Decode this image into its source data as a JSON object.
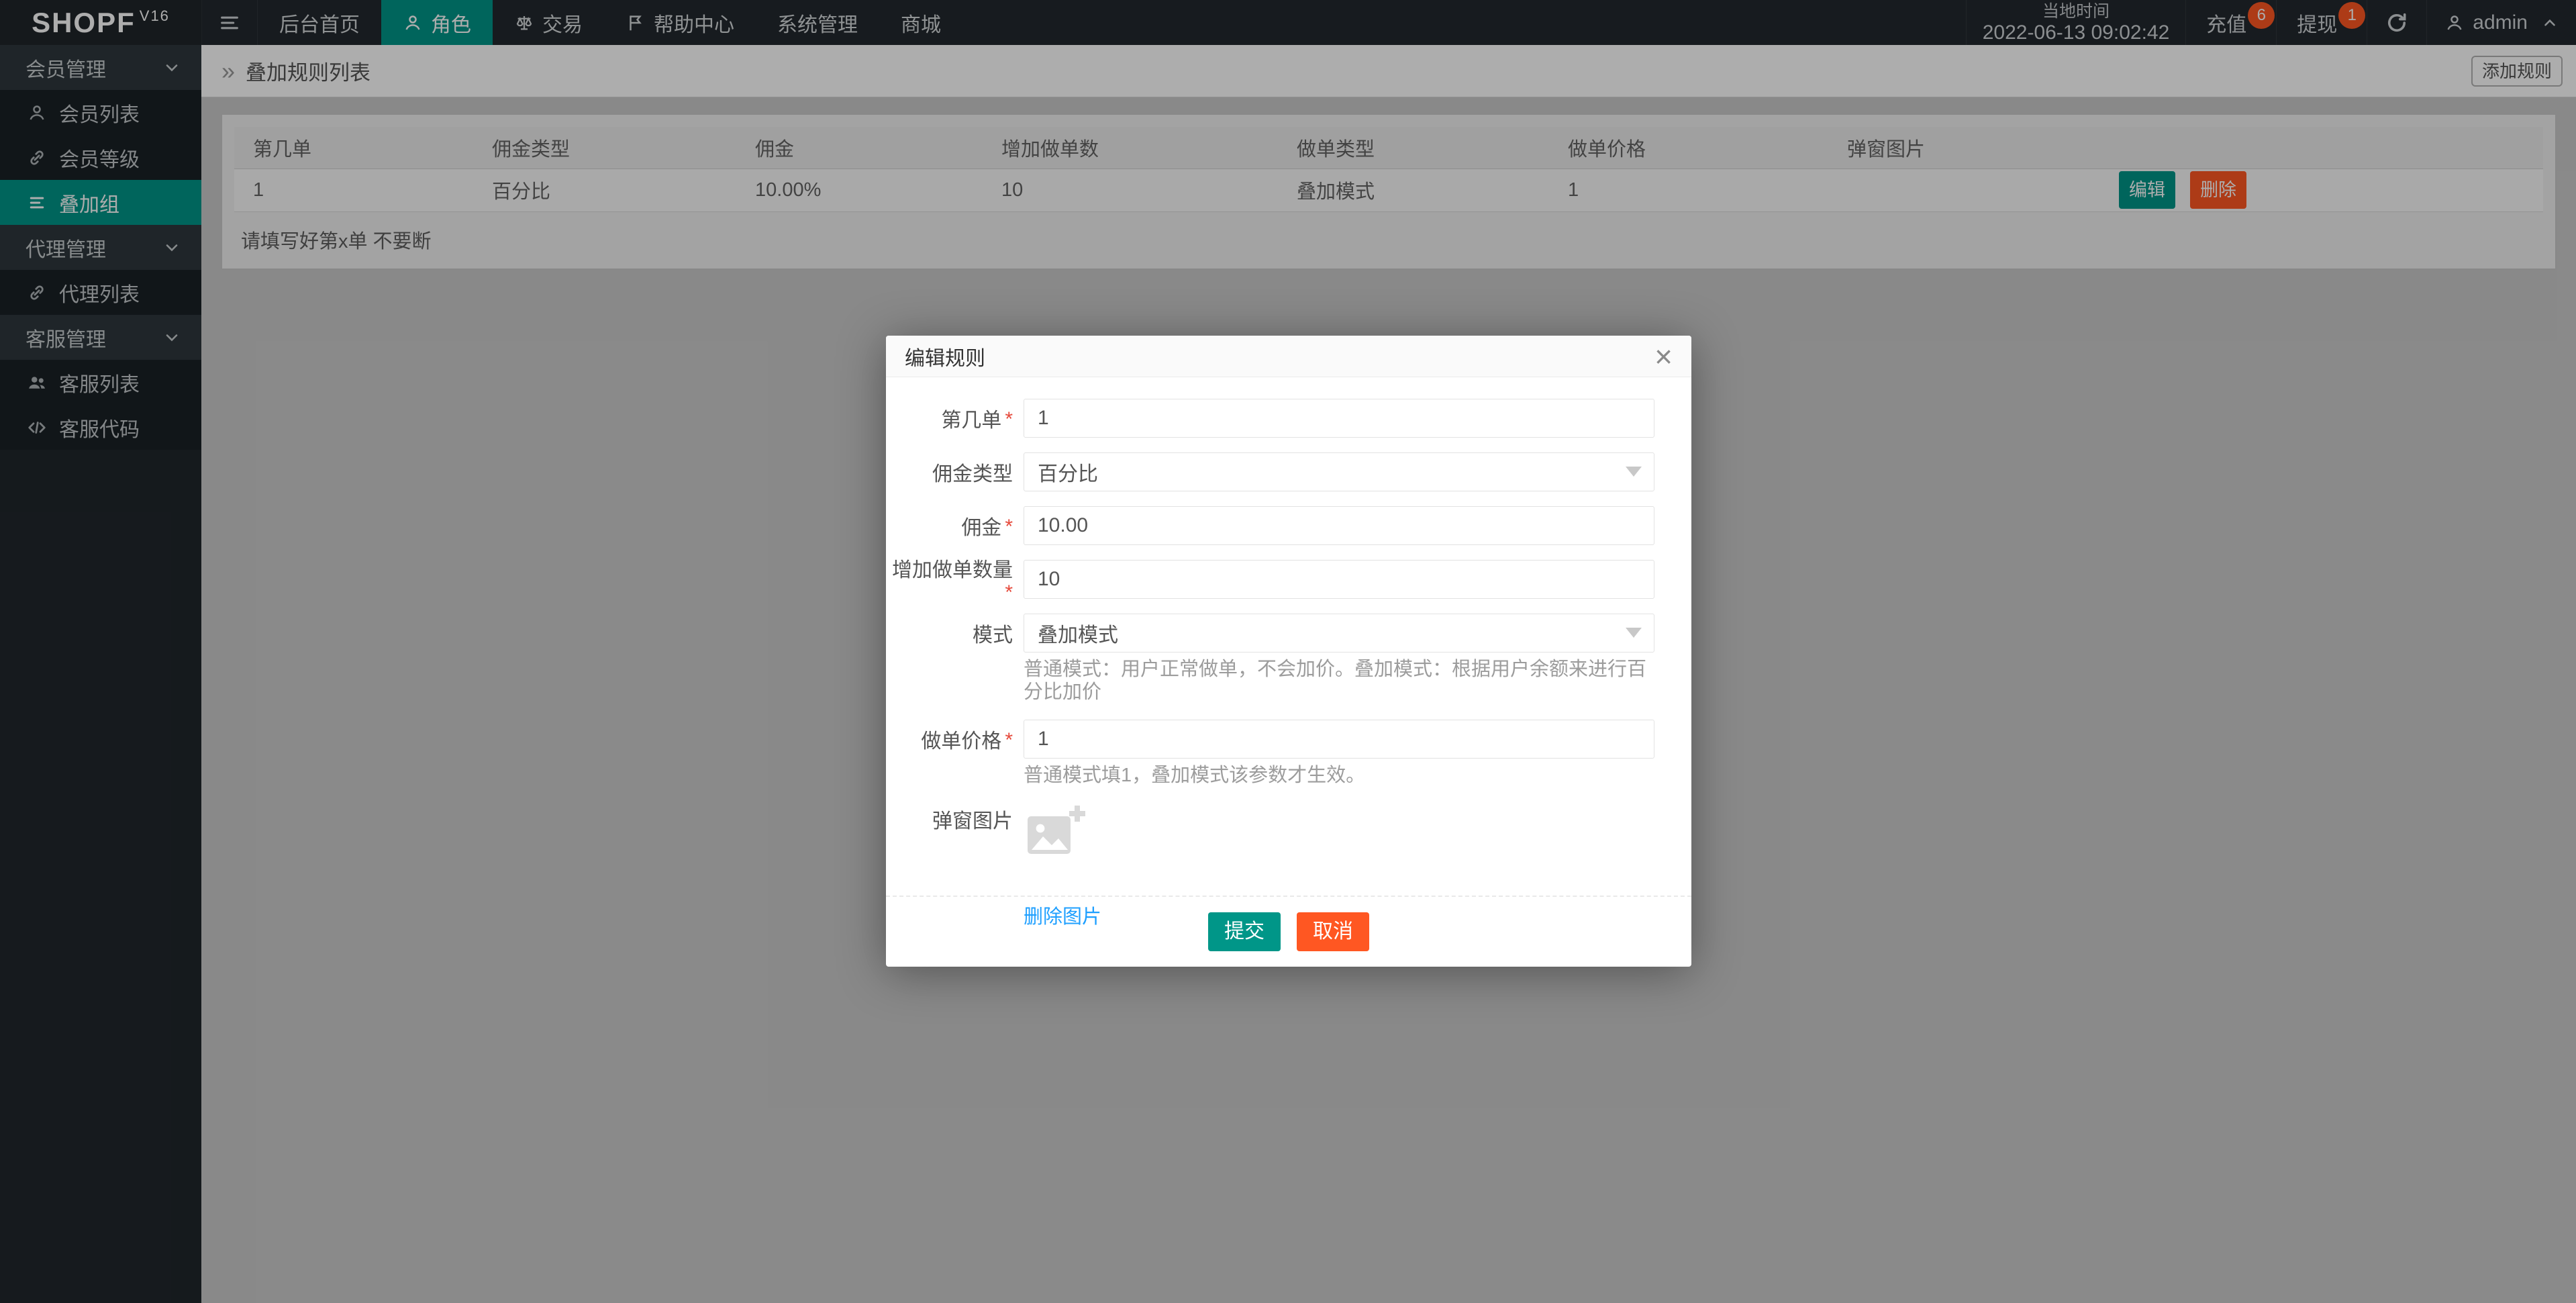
{
  "topbar": {
    "logo": "SHOPF",
    "logo_version": "V16",
    "nav": [
      {
        "label": "后台首页"
      },
      {
        "label": "角色"
      },
      {
        "label": "交易"
      },
      {
        "label": "帮助中心"
      },
      {
        "label": "系统管理"
      },
      {
        "label": "商城"
      }
    ],
    "time_label": "当地时间",
    "time_value": "2022-06-13 09:02:42",
    "recharge_label": "充值",
    "recharge_badge": "6",
    "withdraw_label": "提现",
    "withdraw_badge": "1",
    "username": "admin"
  },
  "sidebar": {
    "items": [
      {
        "label": "会员管理"
      },
      {
        "label": "会员列表"
      },
      {
        "label": "会员等级"
      },
      {
        "label": "叠加组"
      },
      {
        "label": "代理管理"
      },
      {
        "label": "代理列表"
      },
      {
        "label": "客服管理"
      },
      {
        "label": "客服列表"
      },
      {
        "label": "客服代码"
      }
    ]
  },
  "breadcrumb": {
    "chevron": "»",
    "title": "叠加规则列表",
    "add_button": "添加规则"
  },
  "table": {
    "headers": [
      "第几单",
      "佣金类型",
      "佣金",
      "增加做单数",
      "做单类型",
      "做单价格",
      "弹窗图片"
    ],
    "rows": [
      [
        "1",
        "百分比",
        "10.00%",
        "10",
        "叠加模式",
        "1"
      ]
    ],
    "edit_label": "编辑",
    "delete_label": "删除",
    "footnote": "请填写好第x单 不要断"
  },
  "modal": {
    "title": "编辑规则",
    "close": "×",
    "fields": [
      {
        "label": "第几单",
        "value": "1"
      },
      {
        "label": "佣金类型",
        "value": "百分比"
      },
      {
        "label": "佣金",
        "value": "10.00"
      },
      {
        "label": "增加做单数量",
        "value": "10"
      },
      {
        "label": "模式",
        "value": "叠加模式",
        "hint": "普通模式：用户正常做单，不会加价。叠加模式：根据用户余额来进行百分比加价"
      },
      {
        "label": "做单价格",
        "value": "1",
        "hint": "普通模式填1，叠加模式该参数才生效。"
      },
      {
        "label": "弹窗图片",
        "link": "删除图片"
      }
    ],
    "submit": "提交",
    "cancel": "取消"
  },
  "colors": {
    "accent_teal": "#009688",
    "danger_orange": "#ff5722",
    "badge_red": "#ff5722",
    "link_blue": "#1e9fff"
  }
}
